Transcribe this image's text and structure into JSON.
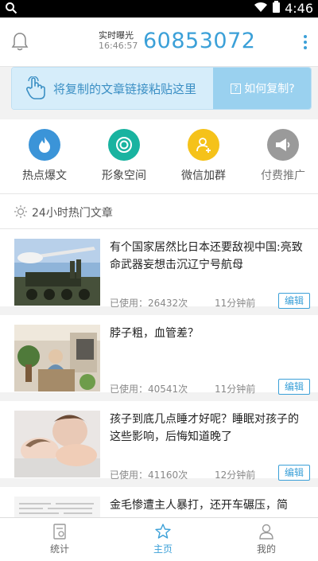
{
  "status_bar": {
    "time": "4:46"
  },
  "header": {
    "exposure_label": "实时曝光",
    "exposure_time": "16:46:57",
    "exposure_count": "60853072"
  },
  "paste_bar": {
    "instruction": "将复制的文章链接粘贴这里",
    "help_label": "如何复制?",
    "help_glyph": "?"
  },
  "quick_nav": [
    {
      "label": "热点爆文",
      "icon": "flame-icon",
      "color": "#3b94d8"
    },
    {
      "label": "形象空间",
      "icon": "chat-bubble-icon",
      "color": "#19b3a0"
    },
    {
      "label": "微信加群",
      "icon": "add-user-icon",
      "color": "#f5c21a"
    },
    {
      "label": "付费推广",
      "icon": "megaphone-icon",
      "color": "#9a9a9a"
    }
  ],
  "section": {
    "title": "24小时热门文章"
  },
  "articles": [
    {
      "title": "有个国家居然比日本还要敌视中国:亮致命武器妄想击沉辽宁号航母",
      "usage": "已使用：26432次",
      "time": "11分钟前",
      "edit": "编辑"
    },
    {
      "title": "脖子粗，血管差？",
      "usage": "已使用：40541次",
      "time": "11分钟前",
      "edit": "编辑"
    },
    {
      "title": "孩子到底几点睡才好呢？睡眠对孩子的这些影响，后悔知道晚了",
      "usage": "已使用：41160次",
      "time": "12分钟前",
      "edit": "编辑"
    },
    {
      "title": "金毛惨遭主人暴打，还开车碾压，简"
    }
  ],
  "bottom_nav": [
    {
      "label": "统计"
    },
    {
      "label": "主页"
    },
    {
      "label": "我的"
    }
  ],
  "colors": {
    "accent": "#3ba0d8"
  }
}
